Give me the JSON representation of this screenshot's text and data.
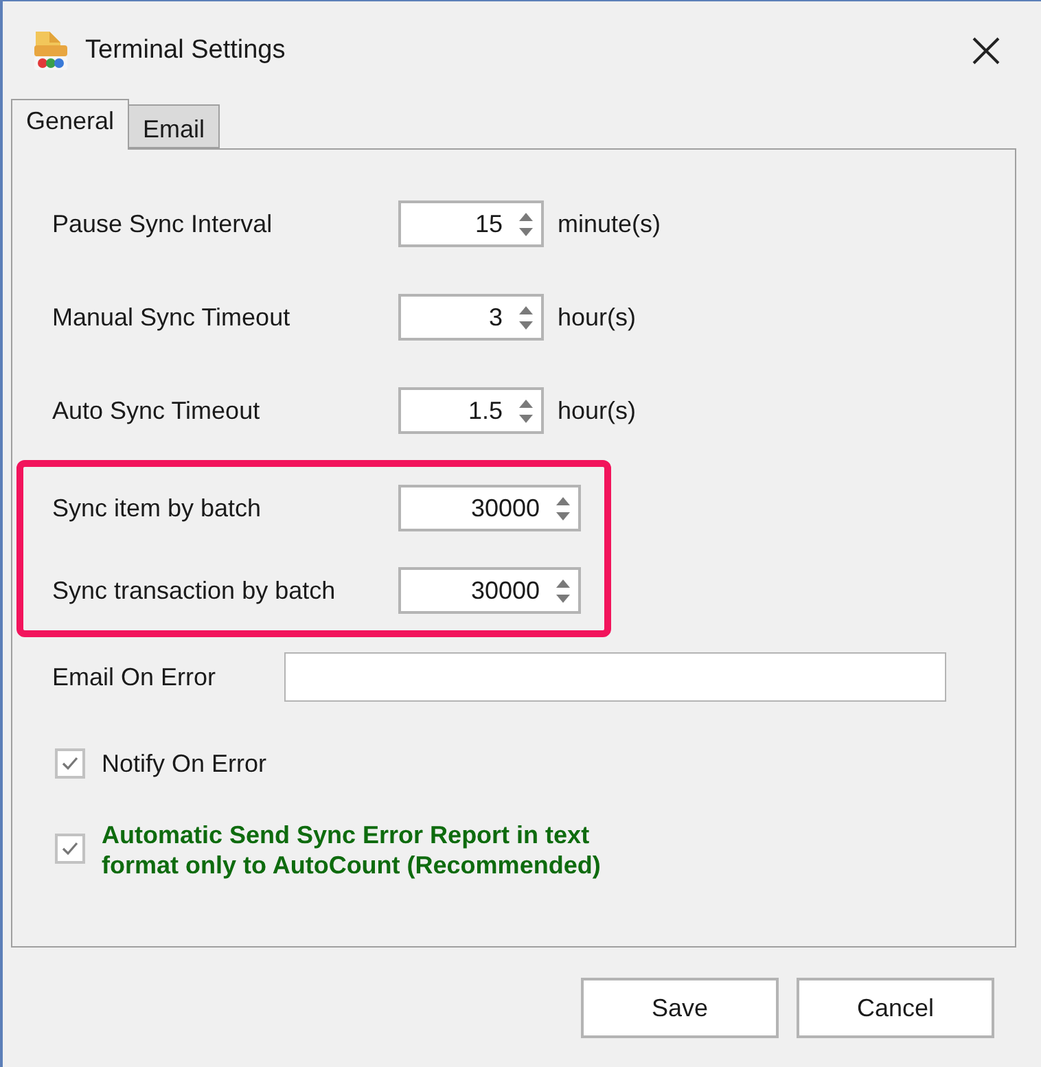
{
  "window": {
    "title": "Terminal Settings"
  },
  "tabs": [
    {
      "label": "General",
      "selected": true
    },
    {
      "label": "Email",
      "selected": false
    }
  ],
  "sync_settings": [
    {
      "label": "Pause Sync Interval",
      "value": "15",
      "unit": "minute(s)"
    },
    {
      "label": "Manual Sync Timeout",
      "value": "3",
      "unit": "hour(s)"
    },
    {
      "label": "Auto Sync Timeout",
      "value": "1.5",
      "unit": "hour(s)"
    }
  ],
  "batch_settings": [
    {
      "label": "Sync item by batch",
      "value": "30000"
    },
    {
      "label": "Sync transaction by batch",
      "value": "30000"
    }
  ],
  "email_on_error": {
    "label": "Email On Error"
  },
  "checkboxes": [
    {
      "kind": "plain",
      "label": "Notify On Error",
      "checked": true
    },
    {
      "kind": "recommended",
      "label": "Automatic Send Sync Error Report in text format only to AutoCount (Recommended)",
      "checked": true
    }
  ],
  "buttons": [
    "Save",
    "Cancel"
  ]
}
